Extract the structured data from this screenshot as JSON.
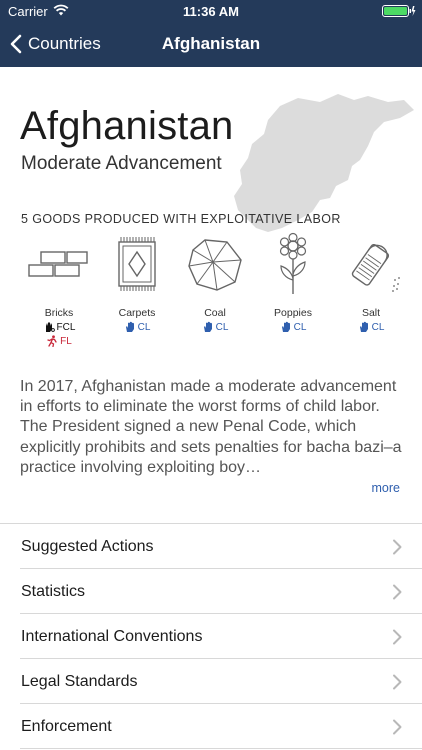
{
  "status_bar": {
    "carrier": "Carrier",
    "time": "11:36 AM"
  },
  "nav": {
    "back_label": "Countries",
    "title": "Afghanistan"
  },
  "country": {
    "name": "Afghanistan",
    "level": "Moderate Advancement"
  },
  "goods_heading": "5 GOODS PRODUCED WITH EXPLOITATIVE LABOR",
  "goods": [
    {
      "name": "Bricks",
      "icon": "bricks-icon",
      "tags": [
        {
          "code": "FCL",
          "kind": "fcl"
        },
        {
          "code": "FL",
          "kind": "fl"
        }
      ]
    },
    {
      "name": "Carpets",
      "icon": "carpet-icon",
      "tags": [
        {
          "code": "CL",
          "kind": "cl"
        }
      ]
    },
    {
      "name": "Coal",
      "icon": "coal-icon",
      "tags": [
        {
          "code": "CL",
          "kind": "cl"
        }
      ]
    },
    {
      "name": "Poppies",
      "icon": "poppy-icon",
      "tags": [
        {
          "code": "CL",
          "kind": "cl"
        }
      ]
    },
    {
      "name": "Salt",
      "icon": "salt-shaker-icon",
      "tags": [
        {
          "code": "CL",
          "kind": "cl"
        }
      ]
    }
  ],
  "description": "In 2017, Afghanistan made a moderate advancement in efforts to eliminate the worst forms of child labor. The President signed a new Penal Code, which explicitly prohibits and sets penalties for bacha bazi–a practice involving exploiting boy…",
  "more_label": "more",
  "sections": [
    "Suggested Actions",
    "Statistics",
    "International Conventions",
    "Legal Standards",
    "Enforcement"
  ],
  "colors": {
    "nav_bg": "#243a5a",
    "link_blue": "#2f5fae",
    "forced_labor_red": "#c8283a",
    "map_gray": "#dcdcdc",
    "battery_green": "#4cd964"
  }
}
